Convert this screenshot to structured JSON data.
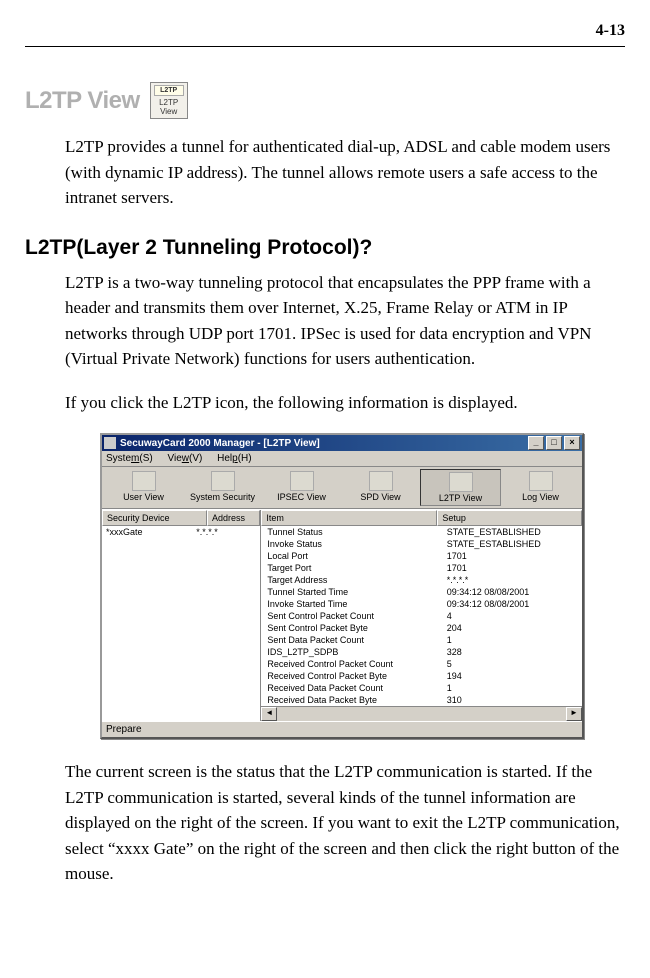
{
  "page_number": "4-13",
  "heading1": "L2TP View",
  "badge": {
    "top": "L2TP",
    "bot": "L2TP View"
  },
  "para1": "L2TP provides a tunnel for authenticated dial-up, ADSL and cable modem users (with dynamic IP address). The tunnel allows remote users a safe access to the intranet servers.",
  "heading2": "L2TP(Layer 2 Tunneling Protocol)?",
  "para2": "L2TP is a two-way tunneling protocol that encapsulates the PPP frame with a header and transmits them over Internet, X.25, Frame Relay or ATM in IP networks through UDP port 1701. IPSec is used for data encryption and VPN (Virtual Private Network) functions for users authentication.",
  "para3": "If you click the L2TP icon, the following information is displayed.",
  "para4": "The current screen is the status that the L2TP communication is started. If the L2TP communication is started, several kinds of the tunnel information are displayed on the right of the screen. If you want to exit the L2TP communication, select “xxxx Gate” on the right of the screen and then click the right button of the mouse.",
  "window": {
    "title": "SecuwayCard 2000 Manager - [L2TP View]",
    "menus": [
      "System(S)",
      "View(V)",
      "Help(H)"
    ],
    "toolbar": [
      "User View",
      "System Security",
      "IPSEC View",
      "SPD View",
      "L2TP View",
      "Log View"
    ],
    "tree": {
      "headers": [
        "Security Device",
        "Address"
      ],
      "rows": [
        [
          "*xxxGate",
          "*.*.*.*"
        ]
      ]
    },
    "list": {
      "headers": [
        "Item",
        "Setup"
      ],
      "rows": [
        [
          "Tunnel Status",
          "STATE_ESTABLISHED"
        ],
        [
          "Invoke Status",
          "STATE_ESTABLISHED"
        ],
        [
          "Local Port",
          "1701"
        ],
        [
          "Target Port",
          "1701"
        ],
        [
          "Target Address",
          "*.*.*.*"
        ],
        [
          "Tunnel Started Time",
          "09:34:12  08/08/2001"
        ],
        [
          "Invoke Started Time",
          "09:34:12  08/08/2001"
        ],
        [
          "Sent Control Packet Count",
          "4"
        ],
        [
          "Sent Control Packet Byte",
          "204"
        ],
        [
          "Sent Data Packet Count",
          "1"
        ],
        [
          "IDS_L2TP_SDPB",
          "328"
        ],
        [
          "Received Control Packet Count",
          "5"
        ],
        [
          "Received Control Packet Byte",
          "194"
        ],
        [
          "Received Data Packet Count",
          "1"
        ],
        [
          "Received Data Packet Byte",
          "310"
        ]
      ]
    },
    "status": "Prepare"
  }
}
